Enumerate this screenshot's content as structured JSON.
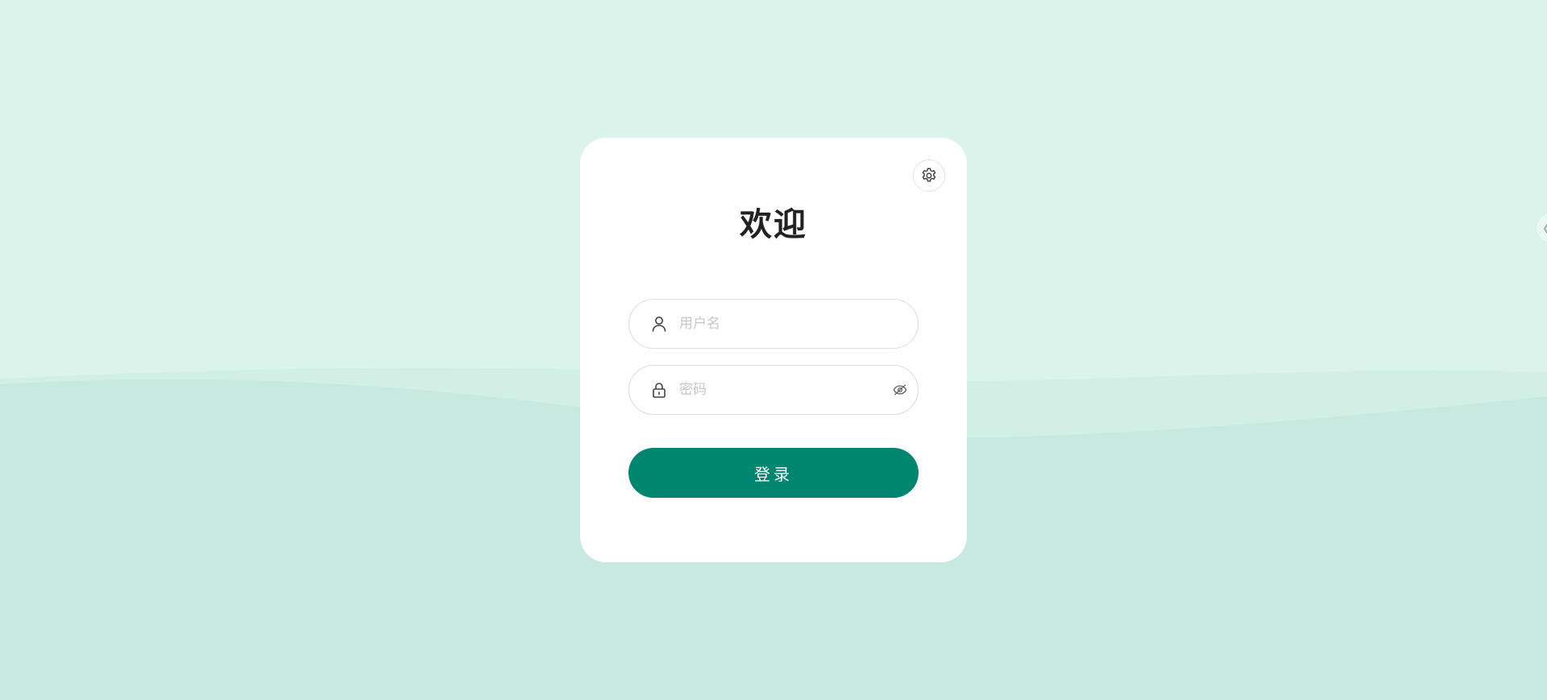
{
  "login": {
    "title": "欢迎",
    "username_placeholder": "用户名",
    "password_placeholder": "密码",
    "submit_label": "登录"
  },
  "icons": {
    "settings": "gear-icon",
    "username": "user-icon",
    "password": "lock-icon",
    "toggle_visibility": "eye-off-icon",
    "side_handle": "chevron-left-icon"
  },
  "colors": {
    "background_top": "#dbf4eb",
    "background_bottom": "#c7e9e0",
    "accent": "#008570",
    "card": "#ffffff"
  }
}
